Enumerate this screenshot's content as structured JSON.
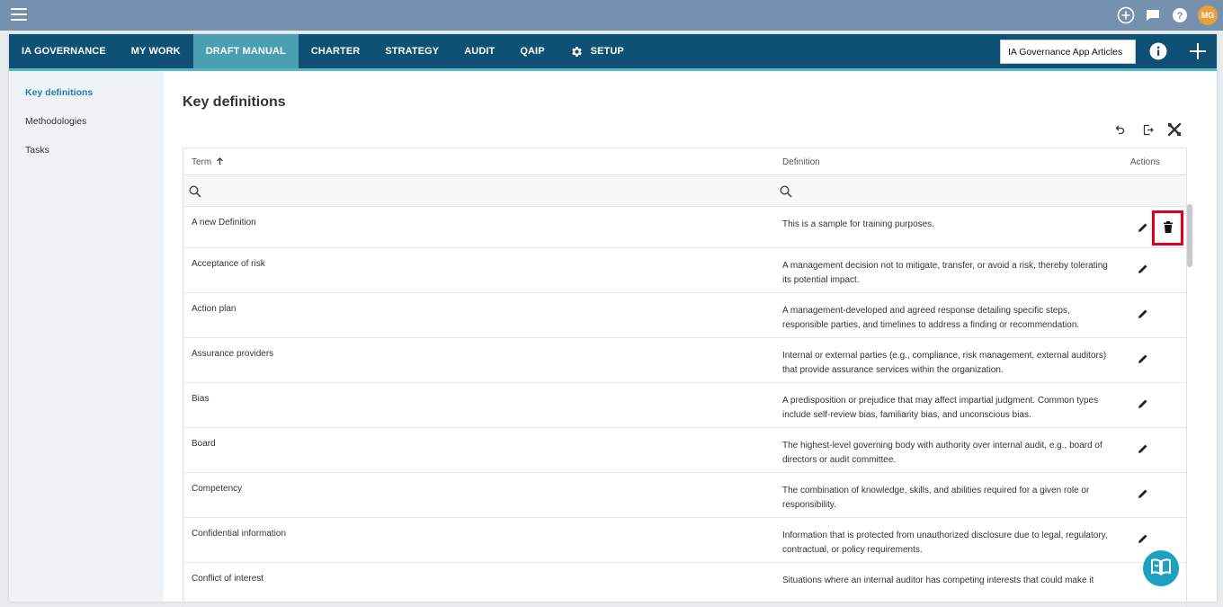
{
  "topbar": {
    "user_initials": "MG",
    "avatar_color": "#e8a13a"
  },
  "nav": {
    "tabs": [
      {
        "label": "IA GOVERNANCE"
      },
      {
        "label": "MY WORK"
      },
      {
        "label": "DRAFT MANUAL",
        "active": true
      },
      {
        "label": "CHARTER"
      },
      {
        "label": "STRATEGY"
      },
      {
        "label": "AUDIT"
      },
      {
        "label": "QAIP"
      },
      {
        "label": "SETUP",
        "icon": "gear-icon"
      }
    ],
    "search_value": "IA Governance App Articles",
    "bg_color": "#0f5175",
    "active_color": "#4a9fb2"
  },
  "sidebar": {
    "items": [
      {
        "label": "Key definitions",
        "active": true
      },
      {
        "label": "Methodologies"
      },
      {
        "label": "Tasks"
      }
    ]
  },
  "main": {
    "title": "Key definitions",
    "columns": {
      "term": "Term",
      "definition": "Definition",
      "actions": "Actions"
    },
    "rows": [
      {
        "term": "A new Definition",
        "definition": "This is a sample for training purposes."
      },
      {
        "term": "Acceptance of risk",
        "definition": "A management decision not to mitigate, transfer, or avoid a risk, thereby tolerating its potential impact."
      },
      {
        "term": "Action plan",
        "definition": "A management-developed and agreed response detailing specific steps, responsible parties, and timelines to address a finding or recommendation."
      },
      {
        "term": "Assurance providers",
        "definition": "Internal or external parties (e.g., compliance, risk management, external auditors) that provide assurance services within the organization."
      },
      {
        "term": "Bias",
        "definition": "A predisposition or prejudice that may affect impartial judgment. Common types include self-review bias, familiarity bias, and unconscious bias."
      },
      {
        "term": "Board",
        "definition": "The highest-level governing body with authority over internal audit, e.g., board of directors or audit committee."
      },
      {
        "term": "Competency",
        "definition": "The combination of knowledge, skills, and abilities required for a given role or responsibility."
      },
      {
        "term": "Confidential information",
        "definition": "Information that is protected from unauthorized disclosure due to legal, regulatory, contractual, or policy requirements."
      },
      {
        "term": "Conflict of interest",
        "definition": "Situations where an internal auditor has competing interests that could make it"
      }
    ],
    "highlight_color": "#e0001b"
  }
}
